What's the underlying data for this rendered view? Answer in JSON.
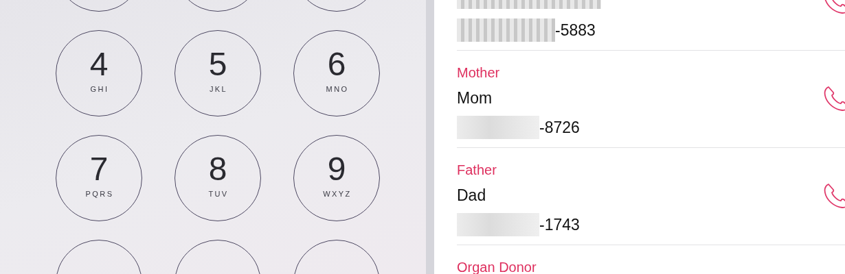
{
  "keypad": {
    "keys": [
      {
        "digit": "4",
        "letters": "GHI"
      },
      {
        "digit": "5",
        "letters": "JKL"
      },
      {
        "digit": "6",
        "letters": "MNO"
      },
      {
        "digit": "7",
        "letters": "PQRS"
      },
      {
        "digit": "8",
        "letters": "TUV"
      },
      {
        "digit": "9",
        "letters": "WXYZ"
      }
    ]
  },
  "emergency_contacts": [
    {
      "number_suffix": "-5883"
    },
    {
      "relation": "Mother",
      "name": "Mom",
      "number_suffix": "-8726"
    },
    {
      "relation": "Father",
      "name": "Dad",
      "number_suffix": "-1743"
    }
  ],
  "next_section": {
    "label": "Organ Donor"
  }
}
